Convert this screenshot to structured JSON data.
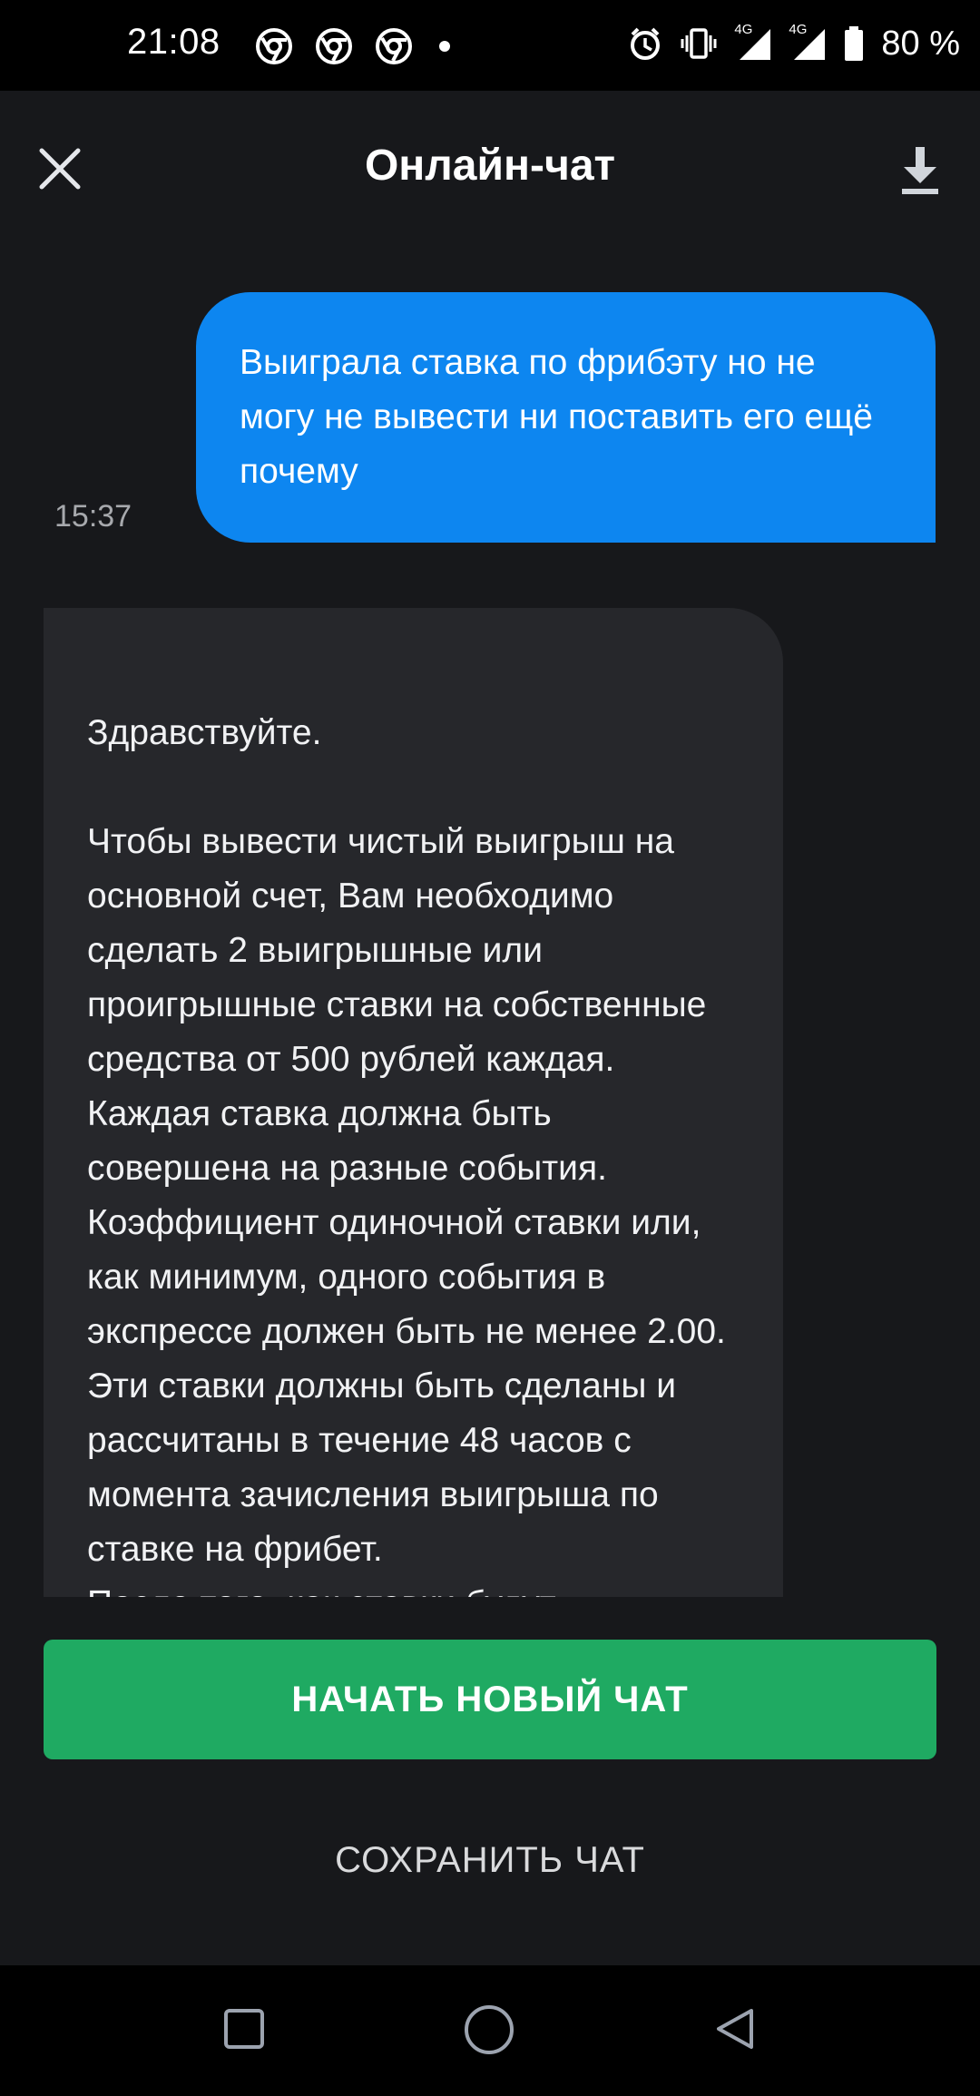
{
  "status_bar": {
    "time": "21:08",
    "battery": "80 %",
    "network_left": "4G",
    "network_right": "4G",
    "icons": [
      "chrome-icon",
      "chrome-icon",
      "chrome-icon",
      "notification-dot",
      "alarm-icon",
      "vibrate-icon",
      "signal-icon",
      "signal-icon",
      "battery-icon"
    ]
  },
  "header": {
    "title": "Онлайн-чат",
    "close_icon": "close-icon",
    "download_icon": "download-icon"
  },
  "messages": [
    {
      "sender": "user",
      "text": "Выиграла ставка по фрибэту но не могу не вывести ни поставить его ещё почему",
      "time": "15:37"
    },
    {
      "sender": "agent",
      "text": "Здравствуйте.\n\nЧтобы вывести чистый выигрыш на основной счет, Вам необходимо сделать 2 выигрышные или проигрышные ставки на собственные средства от 500 рублей каждая. Каждая ставка должна быть совершена на разные события. Коэффициент одиночной ставки или, как минимум, одного события в экспрессе должен быть не менее 2.00. Эти ставки должны быть сделаны и рассчитаны в течение 48 часов с момента зачисления выигрыша по ставке на фрибет.\nПосле того, как ставки будут"
    }
  ],
  "actions": {
    "new_chat": "НАЧАТЬ НОВЫЙ ЧАТ",
    "save_chat": "СОХРАНИТЬ ЧАТ"
  },
  "colors": {
    "background": "#17181b",
    "user_bubble": "#0d86f0",
    "agent_bubble": "#26272b",
    "primary_button": "#1faa62"
  }
}
